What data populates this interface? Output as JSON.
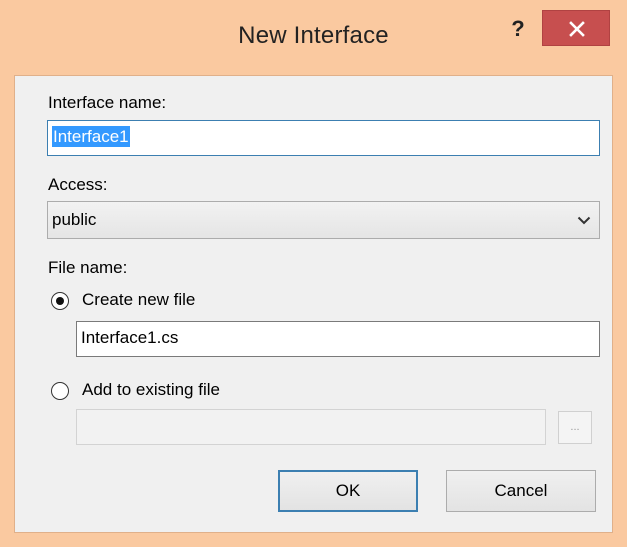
{
  "window": {
    "title": "New Interface",
    "help_label": "?"
  },
  "form": {
    "interface_name_label": "Interface name:",
    "interface_name_value": "Interface1",
    "access_label": "Access:",
    "access_value": "public",
    "file_name_label": "File name:",
    "create_new_label": "Create new file",
    "new_file_value": "Interface1.cs",
    "add_existing_label": "Add to existing file",
    "existing_file_value": "",
    "browse_label": "..."
  },
  "buttons": {
    "ok": "OK",
    "cancel": "Cancel"
  },
  "colors": {
    "frame": "#fac9a0",
    "close_button": "#c74f4f",
    "selection": "#3399ff",
    "focus_border": "#3c7fb1"
  }
}
